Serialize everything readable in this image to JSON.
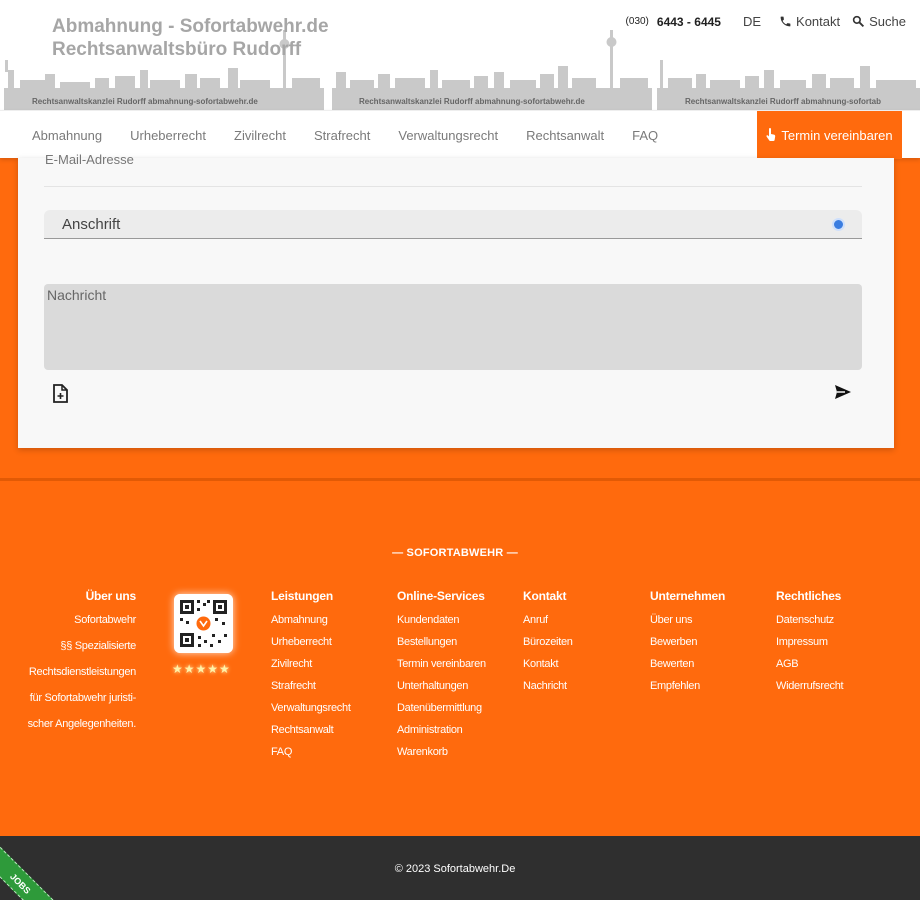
{
  "header": {
    "title_line1": "Abmahnung - Sofortabwehr.de",
    "title_line2": "Rechtsanwaltsbüro Rudorff",
    "phone_prefix": "(030)",
    "phone_number": "6443 - 6445",
    "language": "DE",
    "contact_label": "Kontakt",
    "search_label": "Suche",
    "skyline_caption": "Rechtsanwaltskanzlei Rudorff abmahnung-sofortabwehr.de",
    "skyline_caption_cut": "Rechtsanwaltskanzlei Rudorff abmahnung-sofortab"
  },
  "nav": {
    "items": [
      "Abmahnung",
      "Urheberrecht",
      "Zivilrecht",
      "Strafrecht",
      "Verwaltungsrecht",
      "Rechtsanwalt",
      "FAQ"
    ],
    "cta_label": "Termin vereinbaren"
  },
  "form": {
    "email_label": "E-Mail-Adresse",
    "address_label": "Anschrift",
    "message_placeholder": "Nachricht"
  },
  "footer": {
    "brand": "— SOFORTABWEHR —",
    "about": {
      "title": "Über uns",
      "lines": [
        "Sofortabwehr",
        "§§ Spezialisierte",
        "Rechtsdienstleistungen",
        "für Sofortabwehr juristi-",
        "scher Angelegenheiten."
      ]
    },
    "rating_stars": "★★★★★",
    "columns": [
      {
        "title": "Leistungen",
        "links": [
          "Abmahnung",
          "Urheberrecht",
          "Zivilrecht",
          "Strafrecht",
          "Verwaltungsrecht",
          "Rechtsanwalt",
          "FAQ"
        ]
      },
      {
        "title": "Online-Services",
        "links": [
          "Kundendaten",
          "Bestellungen",
          "Termin vereinbaren",
          "Unterhaltungen",
          "Datenübermittlung",
          "Administration",
          "Warenkorb"
        ]
      },
      {
        "title": "Kontakt",
        "links": [
          "Anruf",
          "Bürozeiten",
          "Kontakt",
          "Nachricht"
        ]
      },
      {
        "title": "Unternehmen",
        "links": [
          "Über uns",
          "Bewerben",
          "Bewerten",
          "Empfehlen"
        ]
      },
      {
        "title": "Rechtliches",
        "links": [
          "Datenschutz",
          "Impressum",
          "AGB",
          "Widerrufsrecht"
        ]
      }
    ],
    "copyright": "© 2023 Sofortabwehr.De",
    "jobs_badge": "JOBS"
  },
  "colors": {
    "accent": "#ff6a0d",
    "bottom_bar": "#2f2f2f",
    "jobs_green": "#2e9a3a"
  }
}
